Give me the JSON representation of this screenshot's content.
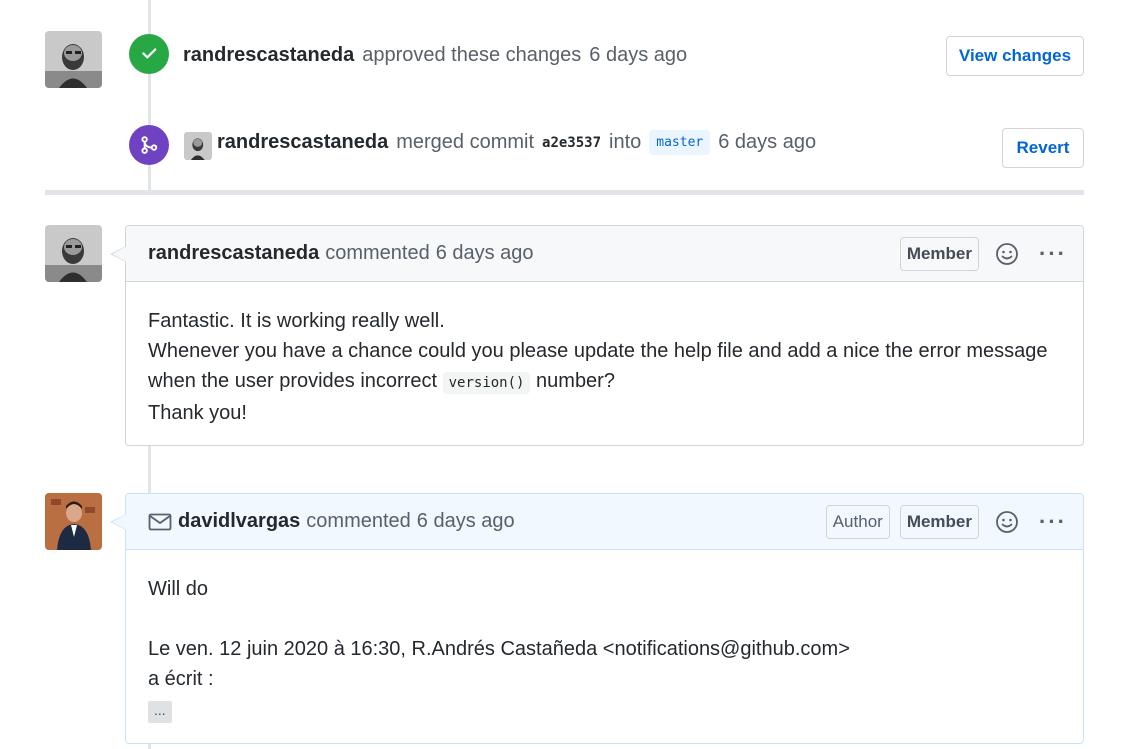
{
  "events": {
    "approved": {
      "user": "randrescastaneda",
      "text": "approved these changes",
      "time": "6 days ago",
      "button": "View changes",
      "icon": "check-icon",
      "color": "#28a745"
    },
    "merged": {
      "user": "randrescastaneda",
      "text_merged": "merged commit",
      "sha": "a2e3537",
      "text_into": "into",
      "branch": "master",
      "time": "6 days ago",
      "button": "Revert",
      "icon": "git-merge-icon",
      "color": "#6f42c1"
    }
  },
  "comments": [
    {
      "user": "randrescastaneda",
      "action": "commented",
      "time": "6 days ago",
      "labels": [
        "Member"
      ],
      "body": {
        "line1": "Fantastic. It is working really well.",
        "line2": "Whenever you have a chance could you please update the help file and add a nice the error message",
        "line3_pre": "when the user provides incorrect",
        "line3_code": "version()",
        "line3_post": "number?",
        "line4": "Thank you!"
      }
    },
    {
      "user": "davidlvargas",
      "action": "commented",
      "time": "6 days ago",
      "labels": [
        "Author",
        "Member"
      ],
      "via_email_icon": "mail-icon",
      "body": {
        "line1": "Will do",
        "line2": "Le ven. 12 juin 2020 à 16:30, R.Andrés Castañeda <notifications@github.com>",
        "line3": "a écrit :",
        "expand": "..."
      }
    }
  ],
  "icons": {
    "reaction": "smiley-icon",
    "more": "kebab-horizontal-icon",
    "more_glyph": "···"
  },
  "colors": {
    "link": "#0366d6",
    "border": "#d1d5da",
    "author_header_bg": "#f1f8ff"
  }
}
